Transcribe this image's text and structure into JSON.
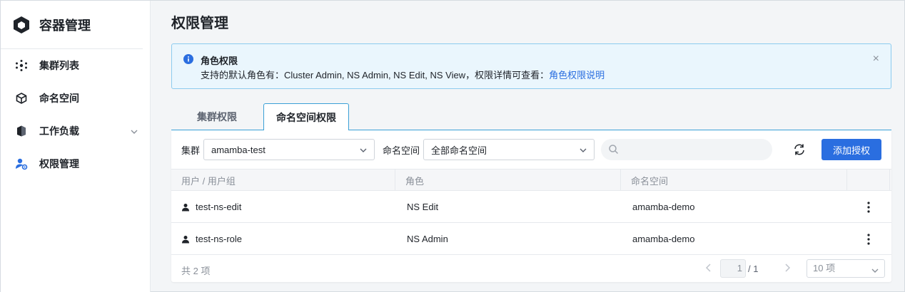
{
  "sidebar": {
    "brand": "容器管理",
    "items": [
      {
        "label": "集群列表",
        "icon": "cluster-icon"
      },
      {
        "label": "命名空间",
        "icon": "cube-icon"
      },
      {
        "label": "工作负载",
        "icon": "workload-icon"
      },
      {
        "label": "权限管理",
        "icon": "user-permission-icon"
      }
    ]
  },
  "page": {
    "title": "权限管理"
  },
  "alert": {
    "title": "角色权限",
    "body": "支持的默认角色有：Cluster Admin, NS Admin, NS Edit, NS View，权限详情可查看：",
    "link": "角色权限说明",
    "close": "×"
  },
  "tabs": [
    {
      "label": "集群权限"
    },
    {
      "label": "命名空间权限"
    }
  ],
  "filters": {
    "cluster_label": "集群",
    "cluster_value": "amamba-test",
    "namespace_label": "命名空间",
    "namespace_value": "全部命名空间",
    "search_placeholder": "",
    "add_button": "添加授权"
  },
  "table": {
    "columns": [
      "用户 / 用户组",
      "角色",
      "命名空间"
    ],
    "rows": [
      {
        "user": "test-ns-edit",
        "role": "NS Edit",
        "namespace": "amamba-demo"
      },
      {
        "user": "test-ns-role",
        "role": "NS Admin",
        "namespace": "amamba-demo"
      }
    ]
  },
  "pagination": {
    "total": "共 2 项",
    "current": "1",
    "of_total": "/ 1",
    "page_size": "10 项"
  },
  "colors": {
    "accent": "#2a6ee0",
    "tab_border": "#3aa0d6",
    "alert_bg": "#eaf6fd"
  }
}
